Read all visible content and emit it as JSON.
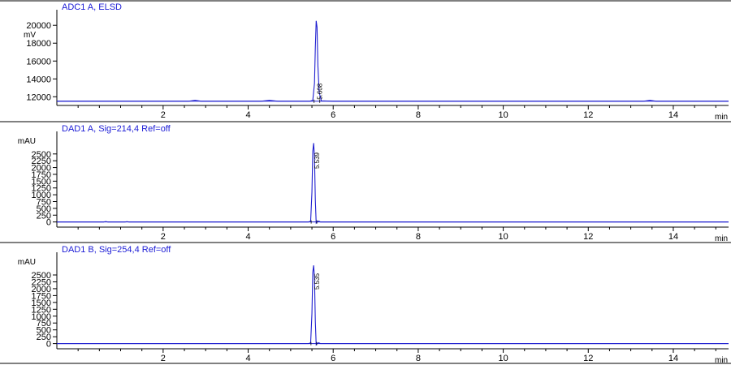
{
  "chart_data": [
    {
      "type": "line",
      "title": "ADC1 A, ELSD",
      "ylabel": "mV",
      "xlabel": "min",
      "xlim": [
        -0.5,
        15.3
      ],
      "ylim": [
        11300,
        21200
      ],
      "xticks": [
        2,
        4,
        6,
        8,
        10,
        12,
        14
      ],
      "yticks": [
        12000,
        14000,
        16000,
        18000,
        20000
      ],
      "baseline": 11500,
      "series": [
        {
          "x": [
            -0.5,
            2.6,
            2.75,
            2.9,
            4.3,
            4.5,
            4.7,
            5.45,
            5.52,
            5.56,
            5.58,
            5.6,
            5.62,
            5.64,
            5.67,
            5.72,
            6.0,
            13.3,
            13.45,
            13.6,
            15.3
          ],
          "y": [
            11500,
            11500,
            11600,
            11500,
            11500,
            11600,
            11500,
            11500,
            11600,
            13500,
            17500,
            20500,
            19800,
            15500,
            12500,
            11550,
            11500,
            11500,
            11600,
            11500,
            11500
          ]
        }
      ],
      "peaks": [
        {
          "x": 5.608,
          "label": "5.608"
        }
      ]
    },
    {
      "type": "line",
      "title": "DAD1 A, Sig=214,4 Ref=off",
      "ylabel": "mAU",
      "xlabel": "min",
      "xlim": [
        -0.5,
        15.3
      ],
      "ylim": [
        -100,
        3150
      ],
      "xticks": [
        2,
        4,
        6,
        8,
        10,
        12,
        14
      ],
      "yticks": [
        0,
        250,
        500,
        750,
        1000,
        1250,
        1500,
        1750,
        2000,
        2250,
        2500
      ],
      "baseline": 0,
      "series": [
        {
          "x": [
            -0.5,
            0.6,
            0.65,
            0.7,
            1.1,
            1.15,
            1.2,
            5.42,
            5.47,
            5.5,
            5.52,
            5.54,
            5.56,
            5.58,
            5.6,
            5.63,
            5.66,
            5.7,
            15.3
          ],
          "y": [
            0,
            0,
            15,
            0,
            0,
            10,
            0,
            0,
            30,
            1100,
            2600,
            2900,
            2400,
            800,
            -40,
            15,
            30,
            0,
            0
          ]
        }
      ],
      "peaks": [
        {
          "x": 5.539,
          "label": "5.539"
        }
      ]
    },
    {
      "type": "line",
      "title": "DAD1 B, Sig=254,4 Ref=off",
      "ylabel": "mAU",
      "xlabel": "min",
      "xlim": [
        -0.5,
        15.3
      ],
      "ylim": [
        -100,
        3150
      ],
      "xticks": [
        2,
        4,
        6,
        8,
        10,
        12,
        14
      ],
      "yticks": [
        0,
        250,
        500,
        750,
        1000,
        1250,
        1500,
        1750,
        2000,
        2250,
        2500
      ],
      "baseline": 0,
      "series": [
        {
          "x": [
            -0.5,
            5.42,
            5.47,
            5.5,
            5.52,
            5.54,
            5.56,
            5.58,
            5.6,
            5.63,
            5.66,
            5.7,
            15.3
          ],
          "y": [
            0,
            0,
            30,
            1100,
            2600,
            2850,
            2400,
            800,
            -40,
            15,
            30,
            0,
            0
          ]
        }
      ],
      "peaks": [
        {
          "x": 5.535,
          "label": "5.535"
        }
      ]
    }
  ]
}
